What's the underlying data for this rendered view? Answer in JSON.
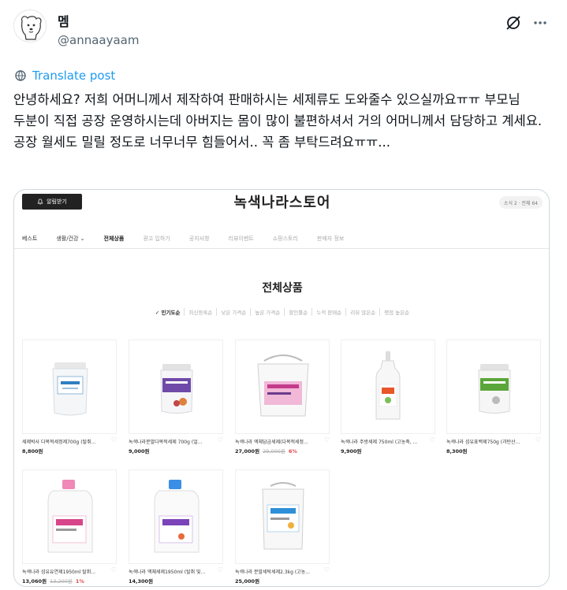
{
  "tweet": {
    "author_name": "멤",
    "author_handle": "@annaayaam",
    "translate_label": "Translate post",
    "text": "안녕하세요? 저희 어머니께서 제작하여 판매하시는 세제류도 도와줄수 있으실까요ㅠㅠ 부모님 두분이 직접 공장 운영하시는데 아버지는 몸이 많이 불편하셔서 거의 어머니께서 담당하고 계세요. 공장 월세도 밀릴 정도로 너무너무 힘들어서.. 꼭 좀 부탁드려요ㅠㅠ..."
  },
  "shop": {
    "alarm_label": "알림받기",
    "title": "녹색나라스토어",
    "stats": "소식 2 · 전체 64",
    "nav": [
      "베스트",
      "생활/건강 ⌄",
      "전체상품",
      "광고 입하기",
      "공지사항",
      "리뷰이벤트",
      "쇼핑스토리",
      "판매자 정보"
    ],
    "section_title": "전체상품",
    "sort": [
      "✓ 인기도순",
      "최신등록순",
      "낮은 가격순",
      "높은 가격순",
      "할인률순",
      "누적 판매순",
      "리뷰 많은순",
      "평점 높은순"
    ],
    "products": [
      {
        "name": "세제박사 다목적세정제700g (탈취...",
        "price": "8,800원",
        "original": "",
        "discount": ""
      },
      {
        "name": "녹색나라분말다목적세제 700g (얼...",
        "price": "9,000원",
        "original": "",
        "discount": ""
      },
      {
        "name": "녹색나라 액체담금세제(다목적세정...",
        "price": "27,000원",
        "original": "29,000원",
        "discount": "6%"
      },
      {
        "name": "녹색나라 주방세제 750ml (고농축, ...",
        "price": "9,900원",
        "original": "",
        "discount": ""
      },
      {
        "name": "녹색나라 섬유표백제750g (과탄산...",
        "price": "8,300원",
        "original": "",
        "discount": ""
      },
      {
        "name": "녹색나라 섬유유연제1950ml 탈취...",
        "price": "13,060원",
        "original": "13,200원",
        "discount": "1%"
      },
      {
        "name": "녹색나라 액체세제1950ml (탈취 및...",
        "price": "14,300원",
        "original": "",
        "discount": ""
      },
      {
        "name": "녹색나라 분말세탁세제2.3kg (고농...",
        "price": "25,000원",
        "original": "",
        "discount": ""
      }
    ]
  },
  "icons": {
    "translate": "translate-globe-icon",
    "grok": "grok-icon",
    "more": "more-horizontal-icon",
    "heart": "heart-icon",
    "bell": "bell-icon"
  },
  "colors": {
    "link": "#1d9bf0",
    "text": "#0f1419",
    "muted": "#536471",
    "discount": "#e0474c"
  }
}
